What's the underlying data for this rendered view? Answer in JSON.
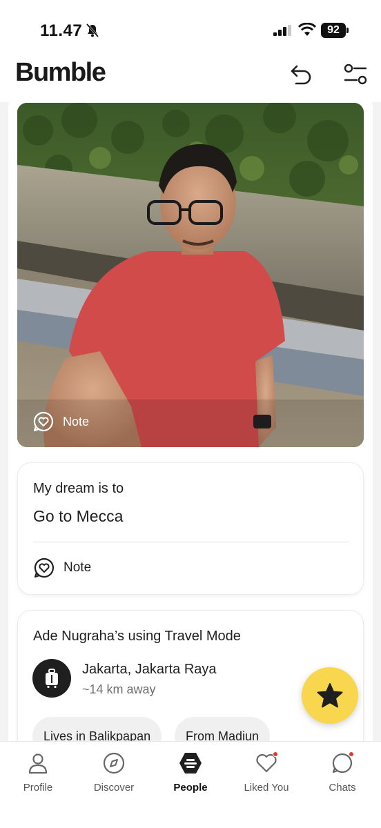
{
  "status_bar": {
    "time": "11.47",
    "battery": "92",
    "icons": [
      "bell-off-icon",
      "cellular-signal-icon",
      "wifi-icon",
      "battery-icon"
    ]
  },
  "header": {
    "logo": "Bumble",
    "undo_icon": "undo-icon",
    "filter_icon": "filter-settings-icon"
  },
  "profile": {
    "photo_note_label": "Note",
    "prompt": {
      "question": "My dream is to",
      "answer": "Go to Mecca",
      "note_label": "Note"
    },
    "travel": {
      "title": "Ade Nugraha’s using Travel Mode",
      "city": "Jakarta, Jakarta Raya",
      "distance": "~14 km away",
      "chips": [
        "Lives in Balikpapan",
        "From Madiun"
      ]
    },
    "superswipe_icon": "star-icon"
  },
  "tabs": [
    {
      "label": "Profile",
      "icon": "person-icon",
      "active": false
    },
    {
      "label": "Discover",
      "icon": "compass-icon",
      "active": false
    },
    {
      "label": "People",
      "icon": "bumble-hexagon-icon",
      "active": true
    },
    {
      "label": "Liked You",
      "icon": "heart-icon",
      "active": false,
      "badge": true
    },
    {
      "label": "Chats",
      "icon": "chat-bubble-icon",
      "active": false,
      "badge": true
    }
  ],
  "colors": {
    "accent_yellow": "#f8d74f",
    "badge_red": "#e5362c",
    "text_dark": "#1f1f1f",
    "text_muted": "#6d6d6d"
  }
}
